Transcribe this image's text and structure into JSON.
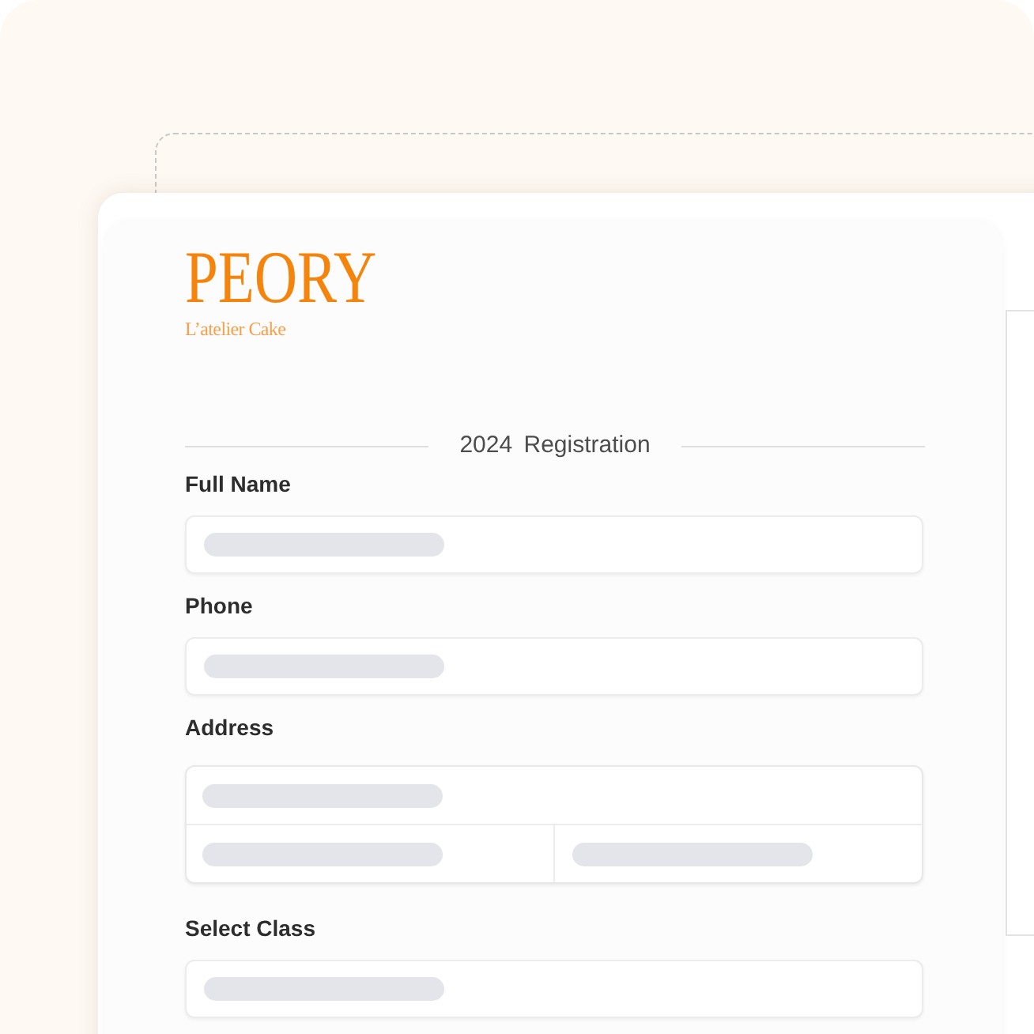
{
  "brand": {
    "name": "PEORY",
    "tagline": "L’atelier Cake"
  },
  "form": {
    "heading": "2024 Registration",
    "fields": [
      {
        "label": "Full Name",
        "kind": "single"
      },
      {
        "label": "Phone",
        "kind": "single"
      },
      {
        "label": "Address",
        "kind": "address"
      },
      {
        "label": "Select Class",
        "kind": "single"
      }
    ]
  }
}
